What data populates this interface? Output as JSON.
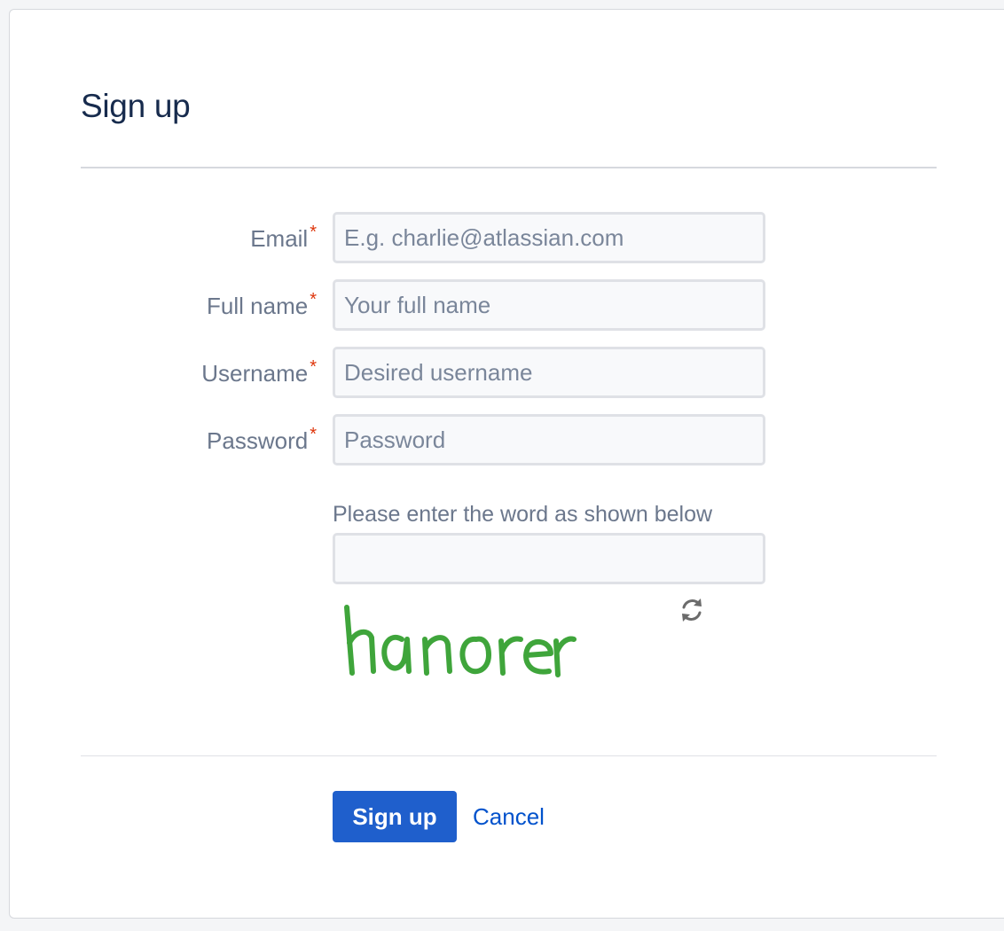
{
  "form": {
    "title": "Sign up",
    "required_marker": "*",
    "fields": [
      {
        "label": "Email",
        "placeholder": "E.g. charlie@atlassian.com",
        "value": ""
      },
      {
        "label": "Full name",
        "placeholder": "Your full name",
        "value": ""
      },
      {
        "label": "Username",
        "placeholder": "Desired username",
        "value": ""
      },
      {
        "label": "Password",
        "placeholder": "Password",
        "value": ""
      }
    ],
    "captcha": {
      "label": "Please enter the word as shown below",
      "value": "",
      "image_word": "hanorer",
      "image_color": "#3fa53b"
    },
    "actions": {
      "submit_label": "Sign up",
      "cancel_label": "Cancel"
    }
  },
  "colors": {
    "accent": "#1f5fcc",
    "link": "#0052cc",
    "required": "#de350b"
  }
}
